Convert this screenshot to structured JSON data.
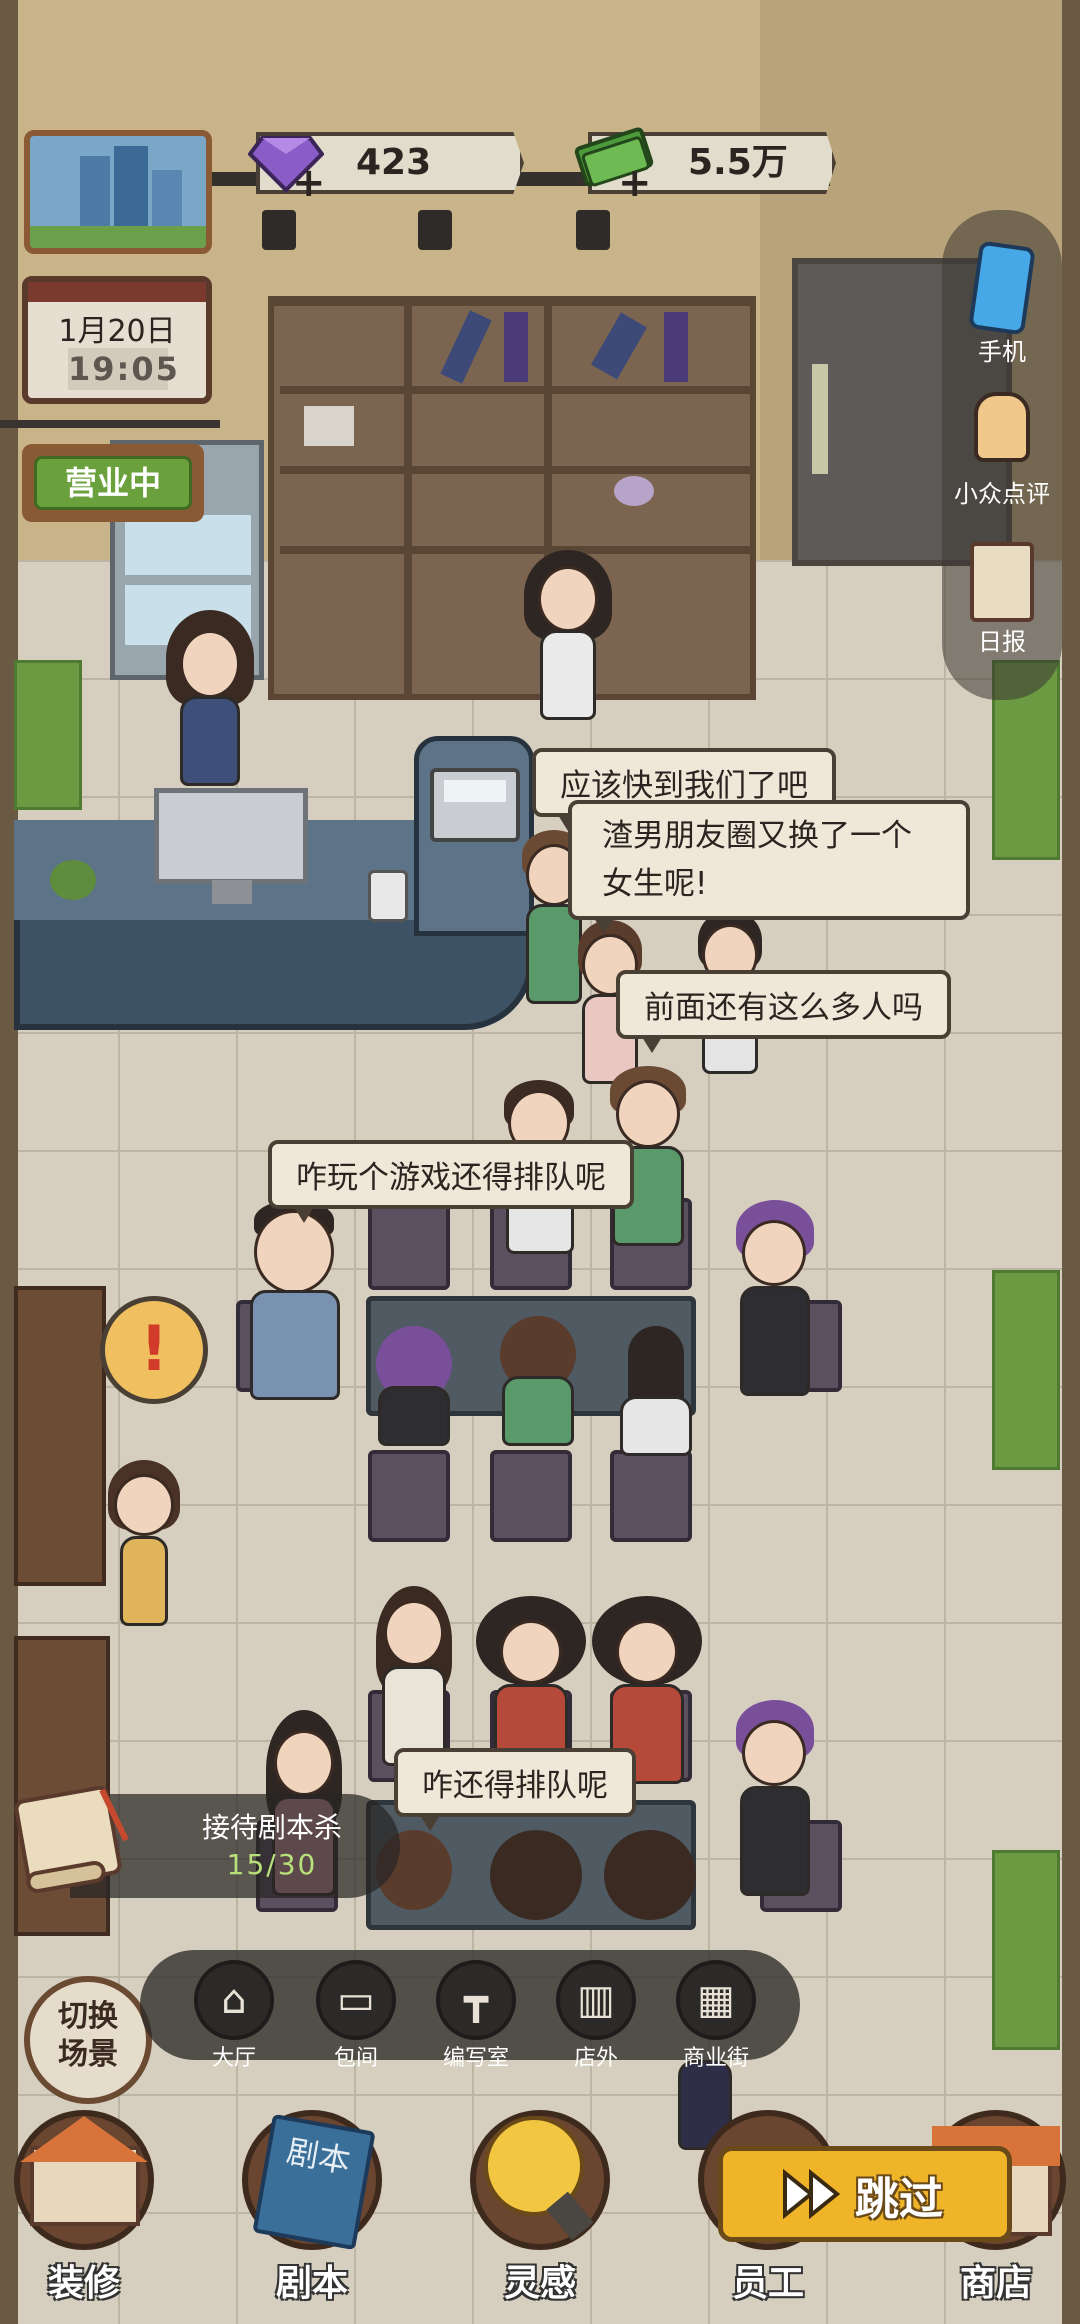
{
  "resources": {
    "gems": "423",
    "cash": "5.5万",
    "plus_sign": "+"
  },
  "date": {
    "day": "1月20日",
    "time": "19:05"
  },
  "status_sign": "营业中",
  "side_menu": [
    {
      "label": "手机",
      "icon": "phone-icon"
    },
    {
      "label": "小众点评",
      "icon": "thumbs-up-icon"
    },
    {
      "label": "日报",
      "icon": "clipboard-icon"
    }
  ],
  "speech_bubbles": [
    "应该快到我们了吧",
    "渣男朋友圈又换了一个女生呢!",
    "前面还有这么多人吗",
    "咋玩个游戏还得排队呢",
    "咋还得排队呢"
  ],
  "alert_mark": "!",
  "task": {
    "title": "接待剧本杀",
    "progress": "15/30",
    "progress_fraction": 0.5
  },
  "switch_scene": "切换\n场景",
  "scene_nav": [
    {
      "label": "大厅",
      "icon": "house-icon"
    },
    {
      "label": "包间",
      "icon": "sofa-icon"
    },
    {
      "label": "编写室",
      "icon": "desk-icon"
    },
    {
      "label": "店外",
      "icon": "storefront-icon"
    },
    {
      "label": "商业街",
      "icon": "shop-street-icon"
    }
  ],
  "bottom_menu": [
    {
      "label": "装修",
      "icon": "renovation-house-icon"
    },
    {
      "label": "剧本",
      "icon": "script-book-icon"
    },
    {
      "label": "灵感",
      "icon": "lightbulb-icon"
    },
    {
      "label": "员工",
      "icon": "staff-icon"
    },
    {
      "label": "商店",
      "icon": "shop-icon"
    }
  ],
  "book_cover_text": "剧本",
  "skip_button": "跳过",
  "colors": {
    "skip_button_bg": "#f0b429",
    "status_sign_bg": "#6aa13d",
    "progress_text": "#b8e07a",
    "gem": "#8a5cc7",
    "cash": "#4c9a3a"
  }
}
